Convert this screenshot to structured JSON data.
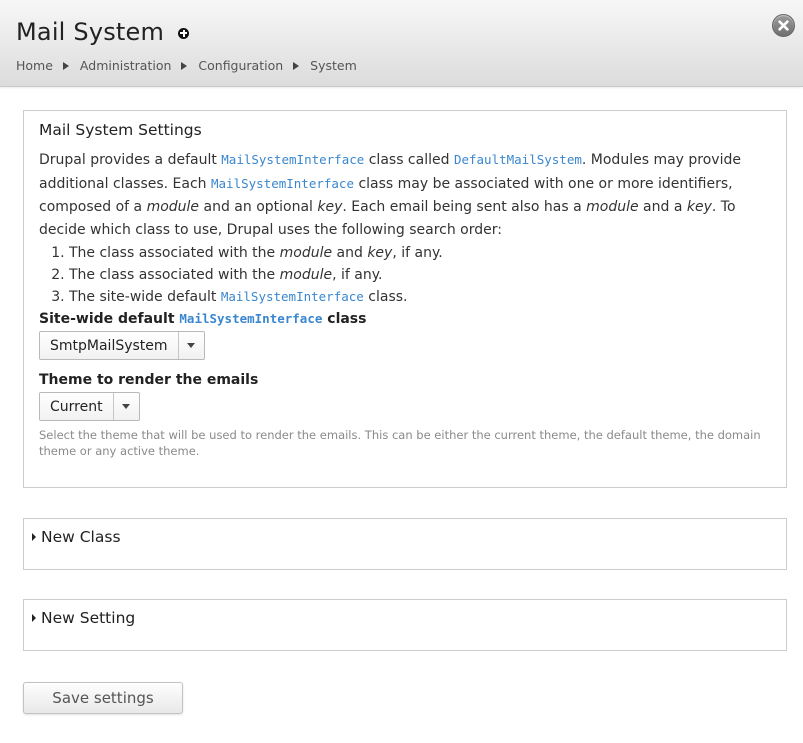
{
  "header": {
    "title": "Mail System",
    "breadcrumb": [
      "Home",
      "Administration",
      "Configuration",
      "System"
    ]
  },
  "settings": {
    "legend": "Mail System Settings",
    "description": {
      "p1": "Drupal provides a default ",
      "code1": "MailSystemInterface",
      "p2": " class called ",
      "code2": "DefaultMailSystem",
      "p3": ". Modules may provide additional classes. Each ",
      "code3": "MailSystemInterface",
      "p4": " class may be associated with one or more identifiers, composed of a ",
      "em1": "module",
      "p5": " and an optional ",
      "em2": "key",
      "p6": ". Each email being sent also has a ",
      "em3": "module",
      "p7": " and a ",
      "em4": "key",
      "p8": ". To decide which class to use, Drupal uses the following search order:"
    },
    "order": {
      "item1": {
        "a": "The class associated with the ",
        "em_a": "module",
        "b": " and ",
        "em_b": "key",
        "c": ", if any."
      },
      "item2": {
        "a": "The class associated with the ",
        "em_a": "module",
        "b": ", if any."
      },
      "item3": {
        "a": "The site-wide default ",
        "code": "MailSystemInterface",
        "b": " class."
      }
    },
    "default_class": {
      "label_a": "Site-wide default ",
      "label_code": "MailSystemInterface",
      "label_b": " class",
      "value": "SmtpMailSystem"
    },
    "theme": {
      "label": "Theme to render the emails",
      "value": "Current",
      "help": "Select the theme that will be used to render the emails. This can be either the current theme, the default theme, the domain theme or any active theme."
    }
  },
  "new_class": {
    "label": "New Class"
  },
  "new_setting": {
    "label": "New Setting"
  },
  "actions": {
    "save_label": "Save settings"
  },
  "colors": {
    "link": "#3a87cf",
    "help_text": "#8a8a8a",
    "header_top": "#f7f7f7",
    "header_bottom": "#dcdcdc"
  },
  "icons": {
    "shortcut": "plus-circle-icon",
    "close": "close-icon",
    "breadcrumb_sep": "triangle-right-icon",
    "select_arrow": "chevron-down-icon",
    "collapse": "triangle-right-icon"
  }
}
